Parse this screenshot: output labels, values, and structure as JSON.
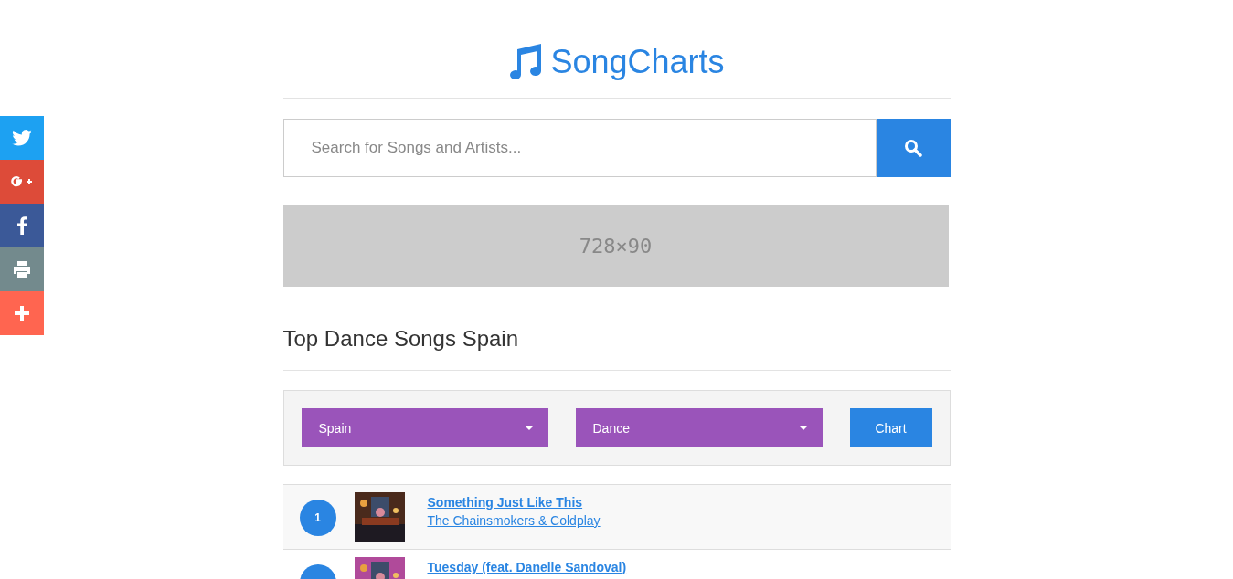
{
  "logo": {
    "text": "SongCharts"
  },
  "social": [
    {
      "kind": "twitter",
      "color": "#1da1f2"
    },
    {
      "kind": "google",
      "color": "#dd4b39"
    },
    {
      "kind": "facebook",
      "color": "#3b5998"
    },
    {
      "kind": "print",
      "color": "#738a8d"
    },
    {
      "kind": "more",
      "color": "#ff6550"
    }
  ],
  "search": {
    "placeholder": "Search for Songs and Artists..."
  },
  "ad": {
    "text": "728×90"
  },
  "heading": "Top Dance Songs Spain",
  "filters": [
    {
      "value": "Spain"
    },
    {
      "value": "Dance"
    }
  ],
  "chart_button": "Chart",
  "songs": [
    {
      "rank": "1",
      "title": "Something Just Like This",
      "artist": "The Chainsmokers & Coldplay"
    },
    {
      "title": "Tuesday (feat. Danelle Sandoval)"
    }
  ]
}
